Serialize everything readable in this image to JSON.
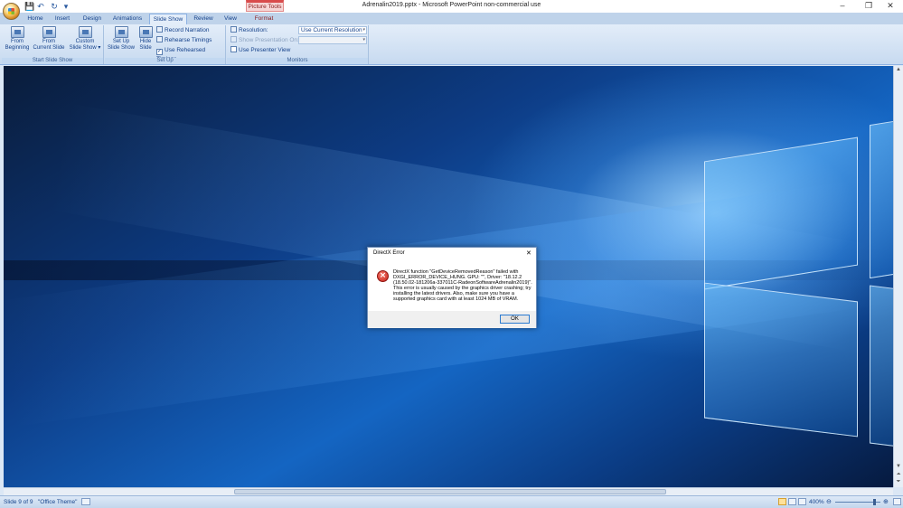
{
  "window": {
    "title": "Adrenalin2019.pptx - Microsoft PowerPoint non-commercial use",
    "contextual_tab": "Picture Tools",
    "controls": {
      "minimize": "–",
      "maximize": "❐",
      "close": "✕"
    }
  },
  "quick_access": {
    "icons": [
      "save-icon",
      "undo-icon",
      "redo-icon",
      "customize-icon"
    ],
    "glyphs": [
      "💾",
      "↶",
      "↻",
      "▾"
    ]
  },
  "tabs": [
    "Home",
    "Insert",
    "Design",
    "Animations",
    "Slide Show",
    "Review",
    "View",
    "Format"
  ],
  "active_tab": "Slide Show",
  "ribbon": {
    "start_group": {
      "label": "Start Slide Show",
      "from_beginning": [
        "From",
        "Beginning"
      ],
      "from_current": [
        "From",
        "Current Slide"
      ],
      "custom": [
        "Custom",
        "Slide Show ▾"
      ]
    },
    "setup_group": {
      "label": "Set Up",
      "setup_show": [
        "Set Up",
        "Slide Show"
      ],
      "hide_slide": [
        "Hide",
        "Slide"
      ],
      "record_narration": "Record Narration",
      "rehearse_timings": "Rehearse Timings",
      "use_rehearsed": "Use Rehearsed Timings",
      "use_rehearsed_checked": true
    },
    "monitors_group": {
      "label": "Monitors",
      "resolution_label": "Resolution:",
      "resolution_value": "Use Current Resolution",
      "show_on_label": "Show Presentation On:",
      "show_on_value": "",
      "presenter_view": "Use Presenter View",
      "presenter_view_checked": false
    }
  },
  "dialog": {
    "title": "DirectX Error",
    "message": "DirectX function \"GetDeviceRemovedReason\" failed with DXGI_ERROR_DEVICE_HUNG. GPU: \"\", Driver: \"18.12.2 (18.50.02-181206a-337011C-RadeonSoftwareAdrenalin2019)\". This error is usually caused by the graphics driver crashing; try installing the latest drivers. Also, make sure you have a supported graphics card with at least 1024 MB of VRAM.",
    "ok_label": "OK",
    "close_glyph": "✕"
  },
  "status": {
    "slide_info": "Slide 9 of 9",
    "theme": "\"Office Theme\"",
    "zoom": "400%"
  },
  "colors": {
    "accent": "#15428b",
    "slide_blue": "#1465c2",
    "error_red": "#c8221a"
  }
}
